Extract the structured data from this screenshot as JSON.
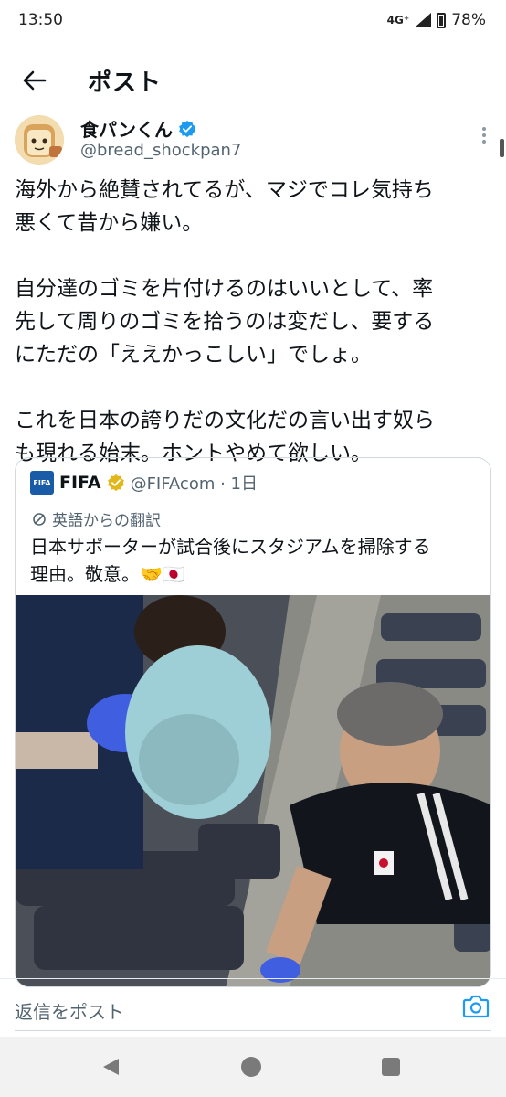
{
  "status_bar": {
    "time": "13:50",
    "network": "4G⁺",
    "battery": "78%",
    "signal_icon": "signal-icon",
    "battery_icon": "battery-icon"
  },
  "header": {
    "back_icon": "arrow-left-icon",
    "title": "ポスト"
  },
  "post": {
    "display_name": "食パンくん",
    "verified_color": "#1d9bf0",
    "handle": "@bread_shockpan7",
    "text_paragraphs": [
      [
        "海外から絶賛されてるが、マジでコレ気持ち",
        "悪くて昔から嫌い。"
      ],
      [
        "自分達のゴミを片付けるのはいいとして、率",
        "先して周りのゴミを拾うのは変だし、要する",
        "にただの「ええかっこしい」でしょ。"
      ],
      [
        "これを日本の誇りだの文化だの言い出す奴ら",
        "も現れる始末。ホントやめて欲しい。"
      ]
    ]
  },
  "quote": {
    "name": "FIFA",
    "logo_text": "FIFA",
    "badge_color": "#e2b719",
    "handle_time": "@FIFAcom · 1日",
    "translation_label": "英語からの翻訳",
    "text_line1": "日本サポーターが試合後にスタジアムを掃除する",
    "text_line2": "理由。敬意。🤝🇯🇵"
  },
  "reply": {
    "placeholder": "返信をポスト",
    "camera_icon": "camera-icon"
  },
  "colors": {
    "accent": "#1d9bf0",
    "text": "#0f1419",
    "secondary": "#536471"
  }
}
